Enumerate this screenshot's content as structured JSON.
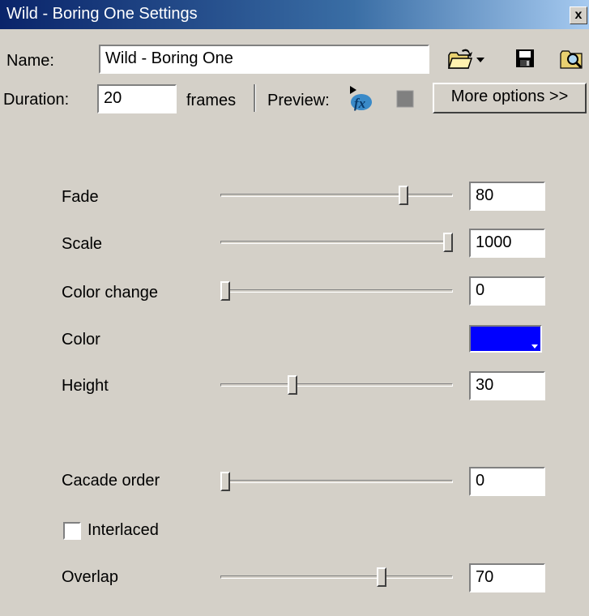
{
  "window": {
    "title": "Wild - Boring One Settings",
    "close_glyph": "x"
  },
  "header": {
    "name_label": "Name:",
    "name_value": "Wild - Boring One",
    "duration_label": "Duration:",
    "duration_value": "20",
    "frames_label": "frames",
    "preview_label": "Preview:",
    "more_options_label": "More options >>",
    "icons": [
      "folder-open-icon",
      "dropdown-arrow-icon",
      "save-icon",
      "find-icon",
      "play-effect-icon",
      "stop-icon"
    ]
  },
  "params": {
    "fade": {
      "label": "Fade",
      "value": "80",
      "level": 0.8
    },
    "scale": {
      "label": "Scale",
      "value": "1000",
      "level": 1.0
    },
    "color_change": {
      "label": "Color change",
      "value": "0",
      "level": 0.0
    },
    "color": {
      "label": "Color",
      "value": "#0000ff"
    },
    "height": {
      "label": "Height",
      "value": "30",
      "level": 0.3
    },
    "cascade_order": {
      "label": "Cacade order",
      "value": "0",
      "level": 0.0
    },
    "interlaced": {
      "label": "Interlaced",
      "checked": false
    },
    "overlap": {
      "label": "Overlap",
      "value": "70",
      "level": 0.7
    }
  },
  "colors": {
    "face": "#d4d0c8",
    "title_start": "#0a246a",
    "swatch": "#0000ff"
  }
}
